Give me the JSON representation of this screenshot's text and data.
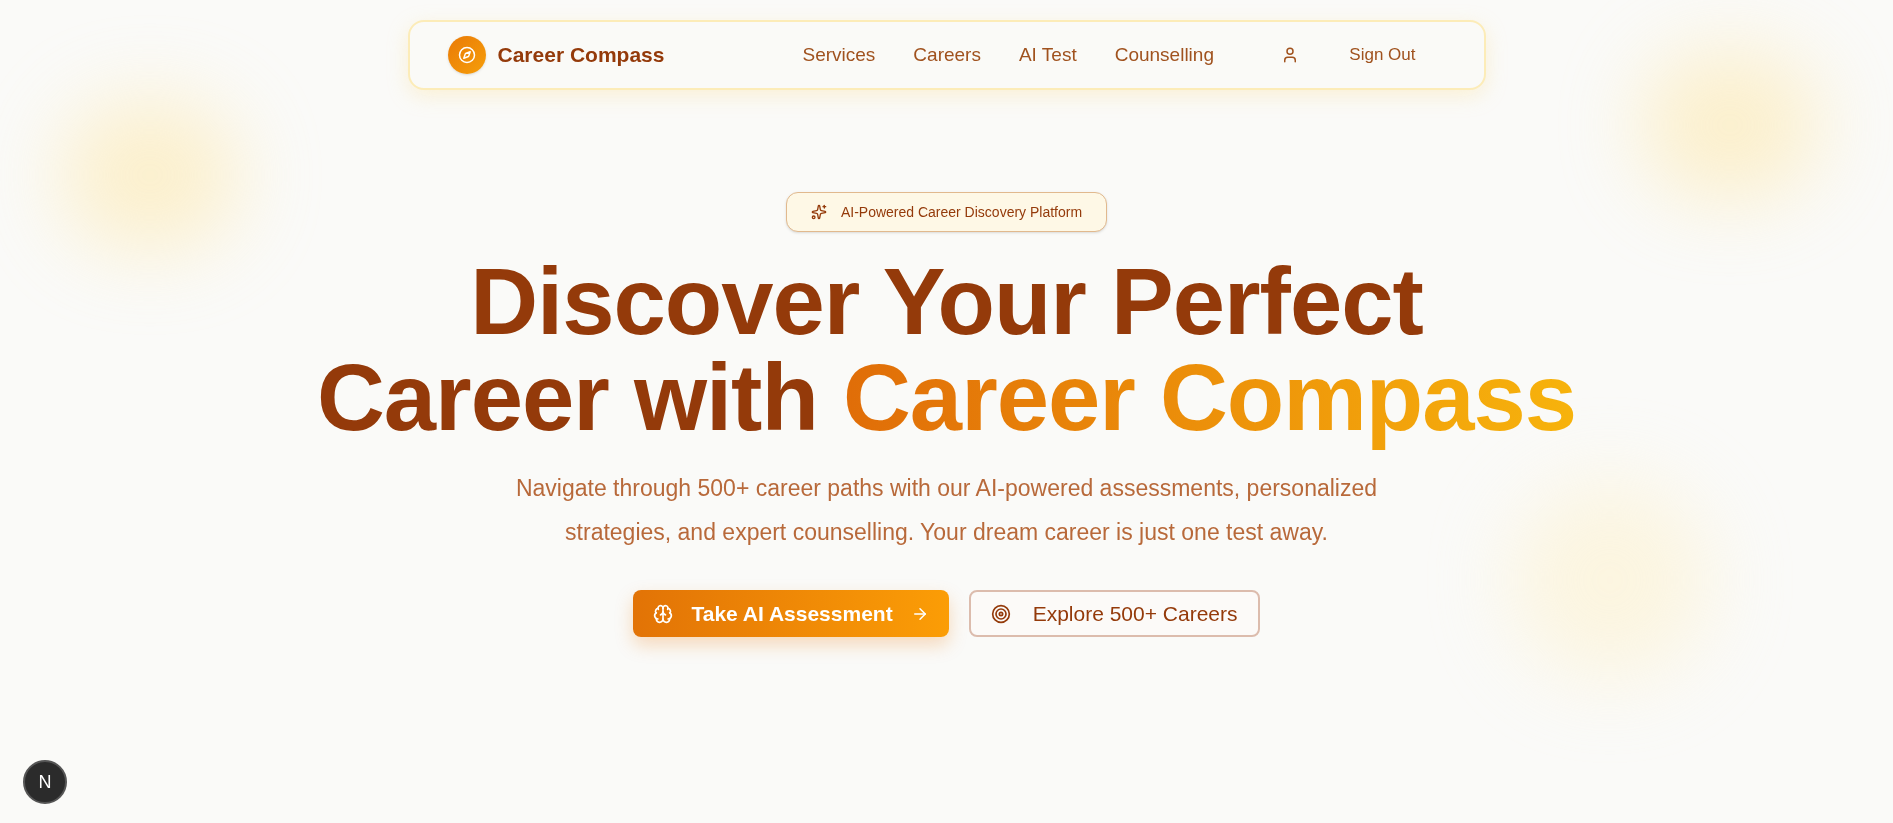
{
  "nav": {
    "brand": "Career Compass",
    "links": [
      {
        "label": "Services"
      },
      {
        "label": "Careers"
      },
      {
        "label": "AI Test"
      },
      {
        "label": "Counselling"
      }
    ],
    "sign_out": "Sign Out"
  },
  "hero": {
    "badge": "AI-Powered Career Discovery Platform",
    "headline_line1": "Discover Your Perfect",
    "headline_line2": "Career with",
    "headline_highlight": "Career Compass",
    "subtitle": "Navigate through 500+ career paths with our AI-powered assessments, personalized strategies, and expert counselling. Your dream career is just one test away.",
    "buttons": [
      {
        "label": "Take AI Assessment",
        "kind": "primary"
      },
      {
        "label": "Explore 500+ Careers",
        "kind": "secondary"
      }
    ]
  },
  "dev_badge": "N"
}
